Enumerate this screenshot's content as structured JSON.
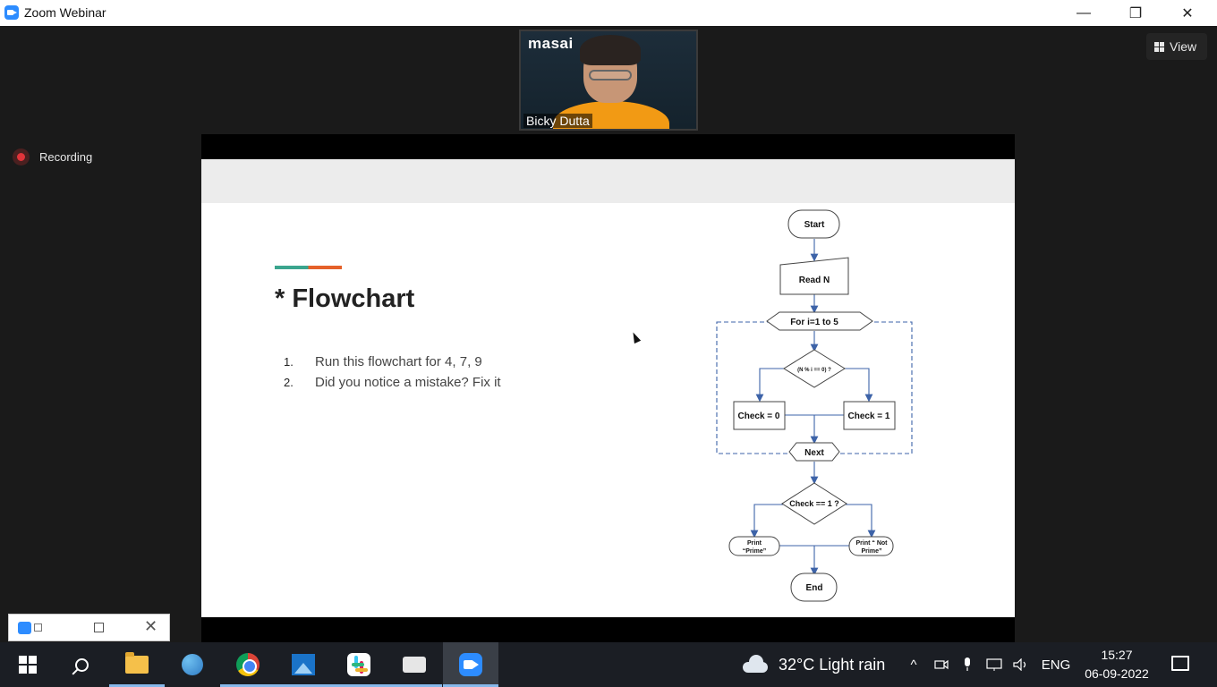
{
  "window": {
    "title": "Zoom Webinar",
    "minimize_glyph": "—",
    "maximize_glyph": "❐",
    "close_glyph": "✕"
  },
  "video": {
    "brand": "masai",
    "participant_name": "Bicky Dutta"
  },
  "view_button": {
    "label": "View"
  },
  "recording": {
    "label": "Recording"
  },
  "slide": {
    "title": "* Flowchart",
    "list": [
      {
        "num": "1.",
        "text": "Run this flowchart for 4, 7, 9"
      },
      {
        "num": "2.",
        "text": "Did you notice a mistake? Fix it"
      }
    ],
    "flowchart": {
      "start": "Start",
      "read": "Read N",
      "loop": "For i=1 to 5",
      "decision1": "(N % i == 0) ?",
      "check0": "Check = 0",
      "check1": "Check = 1",
      "next": "Next",
      "decision2": "Check == 1 ?",
      "print_prime_1": "Print",
      "print_prime_2": "“Prime”",
      "print_not_prime_1": "Print “ Not",
      "print_not_prime_2": "Prime”",
      "end": "End"
    }
  },
  "taskbar": {
    "weather": "32°C  Light rain",
    "language": "ENG",
    "time": "15:27",
    "date": "06-09-2022",
    "up_chevron": "^"
  },
  "colors": {
    "zoom_blue": "#2d8cff",
    "recording_red": "#e0343a",
    "accent_green": "#3ba58e",
    "accent_orange": "#e5612a",
    "flow_line": "#3d63a8"
  }
}
